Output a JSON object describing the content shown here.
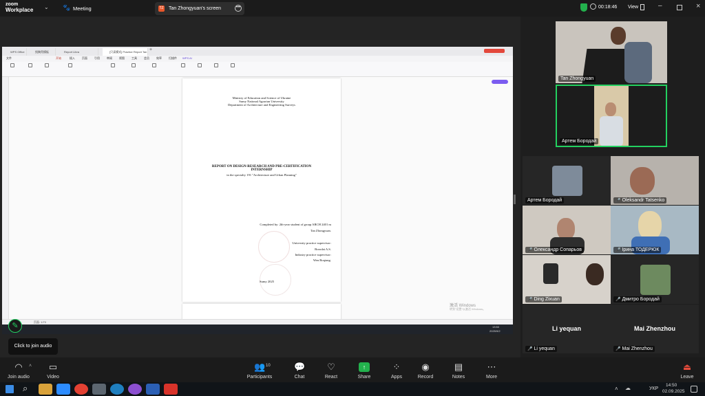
{
  "app": {
    "logo_top": "zoom",
    "logo_bottom": "Workplace",
    "meeting": "Meeting",
    "share_label": "Tan Zhongyuan's screen",
    "timer": "00:18:46",
    "view": "View"
  },
  "doc": {
    "tabs": [
      "WPS Office",
      "找稿壳模板",
      "Report Libra",
      "[只读模式] Practice Report Tan"
    ],
    "menu": [
      "文件",
      "开始",
      "插入",
      "页面",
      "引用",
      "审阅",
      "视图",
      "工具",
      "会员",
      "效率",
      "扫描件",
      "WPS AI"
    ],
    "lines_top": [
      "Ministry of Education and Science of Ukraine",
      "Sumy National Agrarian University",
      "Department of Architecture and Engineering Surveys"
    ],
    "title1": "REPORT ON DESIGN-RESEARCH AND PRE-CERTIFICATION",
    "title2": "INTERNSHIP",
    "subtitle": "in the specialty 191 \"Architecture and Urban Planning\"",
    "right_lines": [
      "Completed by: 2th-year student of group ARCH 2401 m",
      "Tan Zhongyuan.",
      "University practice supervisor:",
      "Borodai A.S.",
      "Industry practice supervisor:",
      "Wen Boqiang."
    ],
    "city": "Sumy 2025",
    "activate1": "激活 Windows",
    "activate2": "转到\"设置\"以激活 Windows。",
    "status": "页面: 1/70",
    "inner_time": "13:50",
    "inner_date": "2025/9/2"
  },
  "participants": [
    {
      "name": "Tan Zhongyuan"
    },
    {
      "name": "Артем Бородай"
    },
    {
      "name": "Артем Бородай"
    },
    {
      "name": "Oleksandr Tatsenko"
    },
    {
      "name": "Олександр Сопарьов"
    },
    {
      "name": "Ірина ТОДЕРЮК"
    },
    {
      "name": "Ding Zixuan"
    },
    {
      "name": "Дмитро Бородай"
    },
    {
      "name": "Li yequan",
      "center": "Li yequan"
    },
    {
      "name": "Mai Zhenzhou",
      "center": "Mai Zhenzhou"
    }
  ],
  "toolbar": {
    "join_audio": "Join audio",
    "video": "Video",
    "participants": "Participants",
    "participants_count": "10",
    "chat": "Chat",
    "react": "React",
    "share": "Share",
    "apps": "Apps",
    "record": "Record",
    "notes": "Notes",
    "more": "More",
    "leave": "Leave",
    "tooltip": "Click to join audio"
  },
  "taskbar": {
    "lang": "УКР",
    "time": "14:50",
    "date": "02.09.2025"
  },
  "colors": {
    "accent": "#2d8cff",
    "share_green": "#23b14d",
    "speaking": "#23d160"
  }
}
